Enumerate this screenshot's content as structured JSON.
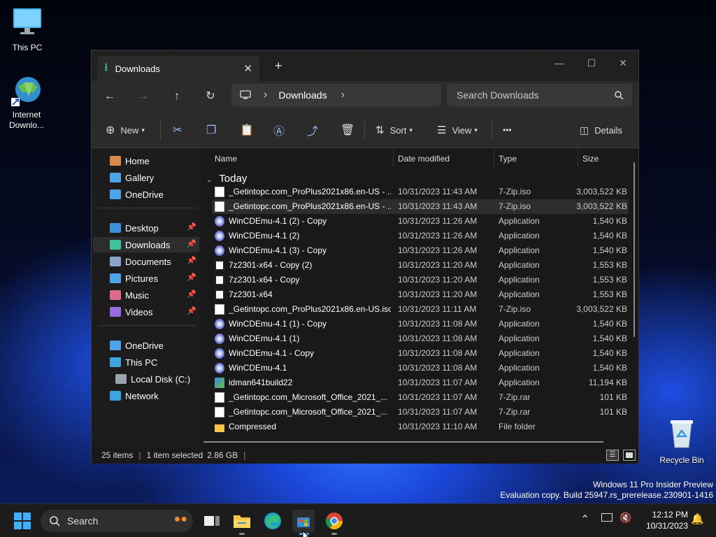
{
  "desktop": {
    "icons": [
      {
        "label": "This PC",
        "icon": "monitor-icon"
      },
      {
        "label": "Internet Downlo...",
        "icon": "idm-globe-icon"
      },
      {
        "label": "Recycle Bin",
        "icon": "recycle-bin-icon"
      }
    ],
    "watermark_line1": "Windows 11 Pro Insider Preview",
    "watermark_line2": "Evaluation copy. Build 25947.rs_prerelease.230901-1416"
  },
  "window": {
    "tab_title": "Downloads",
    "tab_close": "✕",
    "new_tab": "+",
    "controls": {
      "minimize": "—",
      "maximize": "☐",
      "close": "✕"
    }
  },
  "nav": {
    "back": "←",
    "forward": "→",
    "up": "↑",
    "refresh": "↻",
    "breadcrumb_sep": "›",
    "breadcrumb_current": "Downloads",
    "search_placeholder": "Search Downloads"
  },
  "commands": {
    "new": "New",
    "sort": "Sort",
    "view": "View",
    "more": "•••",
    "details": "Details"
  },
  "sidebar": {
    "items": [
      {
        "label": "Home",
        "icon": "home-icon",
        "color": "#d98a4a",
        "pinned": false
      },
      {
        "label": "Gallery",
        "icon": "gallery-icon",
        "color": "#4fa3e8",
        "pinned": false
      },
      {
        "label": "OneDrive",
        "icon": "onedrive-icon",
        "color": "#4fa3e8",
        "pinned": false
      },
      {
        "label": "Desktop",
        "icon": "desktop-icon",
        "color": "#3d8fd9",
        "pinned": true
      },
      {
        "label": "Downloads",
        "icon": "download-icon",
        "color": "#3cc39a",
        "pinned": true
      },
      {
        "label": "Documents",
        "icon": "documents-icon",
        "color": "#8aa4c8",
        "pinned": true
      },
      {
        "label": "Pictures",
        "icon": "pictures-icon",
        "color": "#4fa3e8",
        "pinned": true
      },
      {
        "label": "Music",
        "icon": "music-icon",
        "color": "#e06a8a",
        "pinned": true
      },
      {
        "label": "Videos",
        "icon": "videos-icon",
        "color": "#9a6ae0",
        "pinned": true
      },
      {
        "label": "OneDrive",
        "icon": "onedrive-icon",
        "color": "#4fa3e8",
        "pinned": false
      },
      {
        "label": "This PC",
        "icon": "this-pc-icon",
        "color": "#3da4e0",
        "pinned": false
      },
      {
        "label": "Local Disk (C:)",
        "icon": "disk-icon",
        "color": "#9aa4ae",
        "pinned": false
      },
      {
        "label": "Network",
        "icon": "network-icon",
        "color": "#3da4e0",
        "pinned": false
      }
    ],
    "selected": "Downloads"
  },
  "columns": {
    "name": "Name",
    "date": "Date modified",
    "type": "Type",
    "size": "Size"
  },
  "group_label": "Today",
  "files": [
    {
      "name": "_Getintopc.com_ProPlus2021x86.en-US - ...",
      "date": "10/31/2023 11:43 AM",
      "type": "7-Zip.iso",
      "size": "3,003,522 KB",
      "icon": "file-icon"
    },
    {
      "name": "_Getintopc.com_ProPlus2021x86.en-US - ...",
      "date": "10/31/2023 11:43 AM",
      "type": "7-Zip.iso",
      "size": "3,003,522 KB",
      "icon": "file-icon"
    },
    {
      "name": "WinCDEmu-4.1 (2) - Copy",
      "date": "10/31/2023 11:26 AM",
      "type": "Application",
      "size": "1,540 KB",
      "icon": "wincdemu-icon"
    },
    {
      "name": "WinCDEmu-4.1 (2)",
      "date": "10/31/2023 11:26 AM",
      "type": "Application",
      "size": "1,540 KB",
      "icon": "wincdemu-icon"
    },
    {
      "name": "WinCDEmu-4.1 (3) - Copy",
      "date": "10/31/2023 11:26 AM",
      "type": "Application",
      "size": "1,540 KB",
      "icon": "wincdemu-icon"
    },
    {
      "name": "7z2301-x64 - Copy (2)",
      "date": "10/31/2023 11:20 AM",
      "type": "Application",
      "size": "1,553 KB",
      "icon": "7zip-icon"
    },
    {
      "name": "7z2301-x64 - Copy",
      "date": "10/31/2023 11:20 AM",
      "type": "Application",
      "size": "1,553 KB",
      "icon": "7zip-icon"
    },
    {
      "name": "7z2301-x64",
      "date": "10/31/2023 11:20 AM",
      "type": "Application",
      "size": "1,553 KB",
      "icon": "7zip-icon"
    },
    {
      "name": "_Getintopc.com_ProPlus2021x86.en-US.iso",
      "date": "10/31/2023 11:11 AM",
      "type": "7-Zip.iso",
      "size": "3,003,522 KB",
      "icon": "file-icon"
    },
    {
      "name": "WinCDEmu-4.1 (1) - Copy",
      "date": "10/31/2023 11:08 AM",
      "type": "Application",
      "size": "1,540 KB",
      "icon": "wincdemu-icon"
    },
    {
      "name": "WinCDEmu-4.1 (1)",
      "date": "10/31/2023 11:08 AM",
      "type": "Application",
      "size": "1,540 KB",
      "icon": "wincdemu-icon"
    },
    {
      "name": "WinCDEmu-4.1 - Copy",
      "date": "10/31/2023 11:08 AM",
      "type": "Application",
      "size": "1,540 KB",
      "icon": "wincdemu-icon"
    },
    {
      "name": "WinCDEmu-4.1",
      "date": "10/31/2023 11:08 AM",
      "type": "Application",
      "size": "1,540 KB",
      "icon": "wincdemu-icon"
    },
    {
      "name": "idman641build22",
      "date": "10/31/2023 11:07 AM",
      "type": "Application",
      "size": "11,194 KB",
      "icon": "idm-installer-icon"
    },
    {
      "name": "_Getintopc.com_Microsoft_Office_2021_...",
      "date": "10/31/2023 11:07 AM",
      "type": "7-Zip.rar",
      "size": "101 KB",
      "icon": "file-icon"
    },
    {
      "name": "_Getintopc.com_Microsoft_Office_2021_...",
      "date": "10/31/2023 11:07 AM",
      "type": "7-Zip.rar",
      "size": "101 KB",
      "icon": "file-icon"
    },
    {
      "name": "Compressed",
      "date": "10/31/2023 11:10 AM",
      "type": "File folder",
      "size": "",
      "icon": "folder-icon"
    }
  ],
  "selected_row": 1,
  "status": {
    "items": "25 items",
    "selected": "1 item selected",
    "size": "2.86 GB",
    "sep": "|"
  },
  "taskbar": {
    "search_label": "Search",
    "time": "12:12 PM",
    "date": "10/31/2023",
    "apps": [
      "task-view-icon",
      "file-explorer-icon",
      "edge-icon",
      "store-icon",
      "chrome-icon"
    ]
  },
  "colors": {
    "accent": "#4fa3e8",
    "window_bg": "#191919",
    "toolbar_bg": "#2b2b2b",
    "selection": "#2d2d2d"
  }
}
